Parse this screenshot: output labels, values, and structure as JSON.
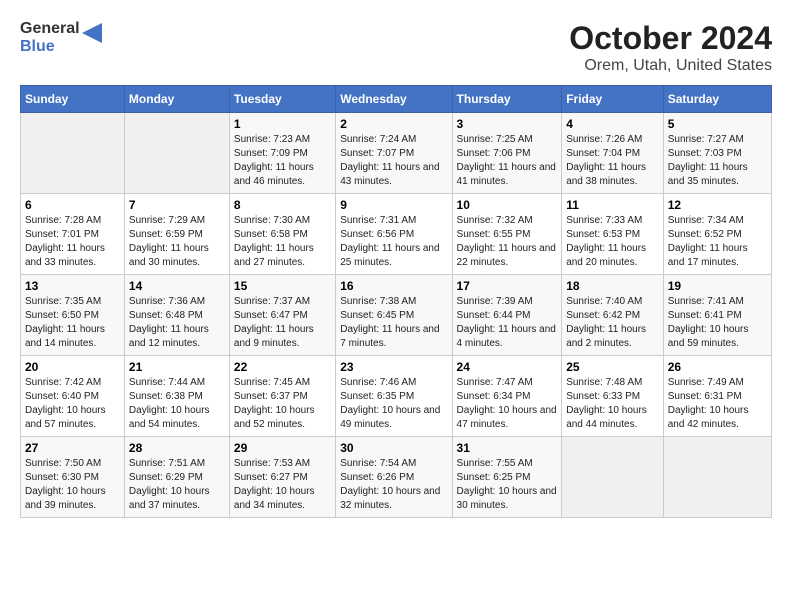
{
  "header": {
    "logo_general": "General",
    "logo_blue": "Blue",
    "title": "October 2024",
    "subtitle": "Orem, Utah, United States"
  },
  "days_of_week": [
    "Sunday",
    "Monday",
    "Tuesday",
    "Wednesday",
    "Thursday",
    "Friday",
    "Saturday"
  ],
  "weeks": [
    [
      {
        "day": "",
        "empty": true
      },
      {
        "day": "",
        "empty": true
      },
      {
        "day": "1",
        "sunrise": "Sunrise: 7:23 AM",
        "sunset": "Sunset: 7:09 PM",
        "daylight": "Daylight: 11 hours and 46 minutes."
      },
      {
        "day": "2",
        "sunrise": "Sunrise: 7:24 AM",
        "sunset": "Sunset: 7:07 PM",
        "daylight": "Daylight: 11 hours and 43 minutes."
      },
      {
        "day": "3",
        "sunrise": "Sunrise: 7:25 AM",
        "sunset": "Sunset: 7:06 PM",
        "daylight": "Daylight: 11 hours and 41 minutes."
      },
      {
        "day": "4",
        "sunrise": "Sunrise: 7:26 AM",
        "sunset": "Sunset: 7:04 PM",
        "daylight": "Daylight: 11 hours and 38 minutes."
      },
      {
        "day": "5",
        "sunrise": "Sunrise: 7:27 AM",
        "sunset": "Sunset: 7:03 PM",
        "daylight": "Daylight: 11 hours and 35 minutes."
      }
    ],
    [
      {
        "day": "6",
        "sunrise": "Sunrise: 7:28 AM",
        "sunset": "Sunset: 7:01 PM",
        "daylight": "Daylight: 11 hours and 33 minutes."
      },
      {
        "day": "7",
        "sunrise": "Sunrise: 7:29 AM",
        "sunset": "Sunset: 6:59 PM",
        "daylight": "Daylight: 11 hours and 30 minutes."
      },
      {
        "day": "8",
        "sunrise": "Sunrise: 7:30 AM",
        "sunset": "Sunset: 6:58 PM",
        "daylight": "Daylight: 11 hours and 27 minutes."
      },
      {
        "day": "9",
        "sunrise": "Sunrise: 7:31 AM",
        "sunset": "Sunset: 6:56 PM",
        "daylight": "Daylight: 11 hours and 25 minutes."
      },
      {
        "day": "10",
        "sunrise": "Sunrise: 7:32 AM",
        "sunset": "Sunset: 6:55 PM",
        "daylight": "Daylight: 11 hours and 22 minutes."
      },
      {
        "day": "11",
        "sunrise": "Sunrise: 7:33 AM",
        "sunset": "Sunset: 6:53 PM",
        "daylight": "Daylight: 11 hours and 20 minutes."
      },
      {
        "day": "12",
        "sunrise": "Sunrise: 7:34 AM",
        "sunset": "Sunset: 6:52 PM",
        "daylight": "Daylight: 11 hours and 17 minutes."
      }
    ],
    [
      {
        "day": "13",
        "sunrise": "Sunrise: 7:35 AM",
        "sunset": "Sunset: 6:50 PM",
        "daylight": "Daylight: 11 hours and 14 minutes."
      },
      {
        "day": "14",
        "sunrise": "Sunrise: 7:36 AM",
        "sunset": "Sunset: 6:48 PM",
        "daylight": "Daylight: 11 hours and 12 minutes."
      },
      {
        "day": "15",
        "sunrise": "Sunrise: 7:37 AM",
        "sunset": "Sunset: 6:47 PM",
        "daylight": "Daylight: 11 hours and 9 minutes."
      },
      {
        "day": "16",
        "sunrise": "Sunrise: 7:38 AM",
        "sunset": "Sunset: 6:45 PM",
        "daylight": "Daylight: 11 hours and 7 minutes."
      },
      {
        "day": "17",
        "sunrise": "Sunrise: 7:39 AM",
        "sunset": "Sunset: 6:44 PM",
        "daylight": "Daylight: 11 hours and 4 minutes."
      },
      {
        "day": "18",
        "sunrise": "Sunrise: 7:40 AM",
        "sunset": "Sunset: 6:42 PM",
        "daylight": "Daylight: 11 hours and 2 minutes."
      },
      {
        "day": "19",
        "sunrise": "Sunrise: 7:41 AM",
        "sunset": "Sunset: 6:41 PM",
        "daylight": "Daylight: 10 hours and 59 minutes."
      }
    ],
    [
      {
        "day": "20",
        "sunrise": "Sunrise: 7:42 AM",
        "sunset": "Sunset: 6:40 PM",
        "daylight": "Daylight: 10 hours and 57 minutes."
      },
      {
        "day": "21",
        "sunrise": "Sunrise: 7:44 AM",
        "sunset": "Sunset: 6:38 PM",
        "daylight": "Daylight: 10 hours and 54 minutes."
      },
      {
        "day": "22",
        "sunrise": "Sunrise: 7:45 AM",
        "sunset": "Sunset: 6:37 PM",
        "daylight": "Daylight: 10 hours and 52 minutes."
      },
      {
        "day": "23",
        "sunrise": "Sunrise: 7:46 AM",
        "sunset": "Sunset: 6:35 PM",
        "daylight": "Daylight: 10 hours and 49 minutes."
      },
      {
        "day": "24",
        "sunrise": "Sunrise: 7:47 AM",
        "sunset": "Sunset: 6:34 PM",
        "daylight": "Daylight: 10 hours and 47 minutes."
      },
      {
        "day": "25",
        "sunrise": "Sunrise: 7:48 AM",
        "sunset": "Sunset: 6:33 PM",
        "daylight": "Daylight: 10 hours and 44 minutes."
      },
      {
        "day": "26",
        "sunrise": "Sunrise: 7:49 AM",
        "sunset": "Sunset: 6:31 PM",
        "daylight": "Daylight: 10 hours and 42 minutes."
      }
    ],
    [
      {
        "day": "27",
        "sunrise": "Sunrise: 7:50 AM",
        "sunset": "Sunset: 6:30 PM",
        "daylight": "Daylight: 10 hours and 39 minutes."
      },
      {
        "day": "28",
        "sunrise": "Sunrise: 7:51 AM",
        "sunset": "Sunset: 6:29 PM",
        "daylight": "Daylight: 10 hours and 37 minutes."
      },
      {
        "day": "29",
        "sunrise": "Sunrise: 7:53 AM",
        "sunset": "Sunset: 6:27 PM",
        "daylight": "Daylight: 10 hours and 34 minutes."
      },
      {
        "day": "30",
        "sunrise": "Sunrise: 7:54 AM",
        "sunset": "Sunset: 6:26 PM",
        "daylight": "Daylight: 10 hours and 32 minutes."
      },
      {
        "day": "31",
        "sunrise": "Sunrise: 7:55 AM",
        "sunset": "Sunset: 6:25 PM",
        "daylight": "Daylight: 10 hours and 30 minutes."
      },
      {
        "day": "",
        "empty": true
      },
      {
        "day": "",
        "empty": true
      }
    ]
  ]
}
